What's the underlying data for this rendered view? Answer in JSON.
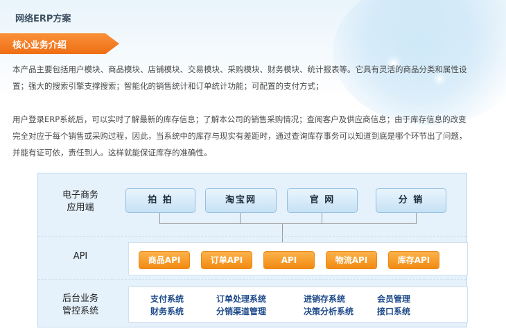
{
  "page": {
    "title": "网络ERP方案"
  },
  "section": {
    "label": "核心业务介绍"
  },
  "intro": {
    "p1": [
      "本产品主要包括用户模块、商品模块、店铺模块、交易模块、采购模块、财务模块、统计报表等。它具有灵活的商品分类和属性设",
      "置；强大的搜索引擎支撑搜索；智能化的销售统计和订单统计功能；可配置的支付方式；"
    ],
    "p2": [
      "用户登录ERP系统后，可以实时了解最新的库存信息；了解本公司的销售采购情况；查阅客户及供应商信息；由于库存信息的改变",
      "完全对应于每个销售或采购过程，因此，当系统中的库存与现实有差距时，通过查询库存事务可以知道到底是哪个环节出了问题，",
      "并能有证可依，责任到人。这样就能保证库存的准确性。"
    ]
  },
  "diagram": {
    "ecommerce": {
      "label_line1": "电子商务",
      "label_line2": "应用端",
      "nodes": [
        "拍 拍",
        "淘宝网",
        "官 网",
        "分 销"
      ]
    },
    "api": {
      "label": "API",
      "buttons": [
        "商品API",
        "订单API",
        "API",
        "物流API",
        "库存API"
      ]
    },
    "backend": {
      "label_line1": "后台业务",
      "label_line2": "管控系统",
      "row1": [
        "支付系统",
        "订单处理系统",
        "进销存系统",
        "会员管理"
      ],
      "row2": [
        "财务系统",
        "分销渠道管理",
        "决策分析系统",
        "接口系统"
      ]
    }
  },
  "colors": {
    "accent": "#f07a1a",
    "node_border": "#95bfe0",
    "diagram_bg": "#e5f1fb",
    "system_text": "#1e4a8a"
  }
}
